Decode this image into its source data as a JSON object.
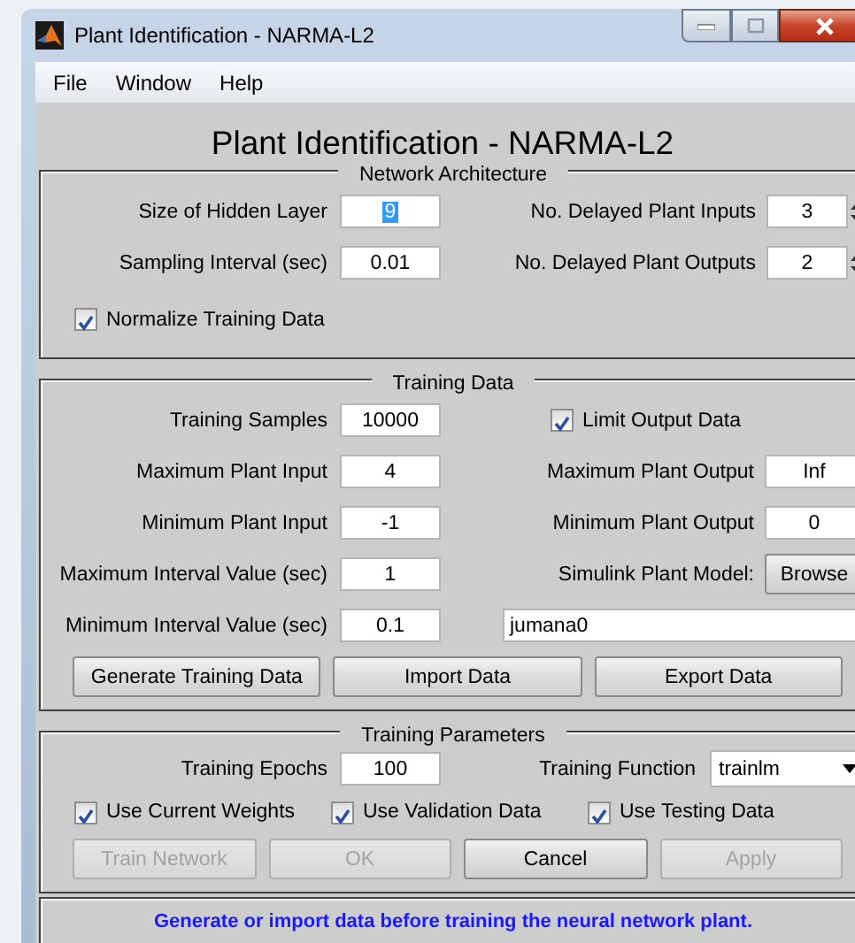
{
  "window": {
    "title": "Plant Identification - NARMA-L2"
  },
  "menu": [
    "File",
    "Window",
    "Help"
  ],
  "heading": "Plant Identification - NARMA-L2",
  "panels": [
    {
      "title": "Network Architecture",
      "rows": [
        {
          "kind": "pair",
          "items": [
            {
              "kind": "field",
              "label": "Size of Hidden Layer",
              "value": "9",
              "text_selected": true
            },
            {
              "kind": "spinner",
              "label": "No. Delayed Plant Inputs",
              "value": "3",
              "text_selected": false
            }
          ]
        },
        {
          "kind": "pair",
          "items": [
            {
              "kind": "field",
              "label": "Sampling Interval (sec)",
              "value": "0.01",
              "text_selected": false
            },
            {
              "kind": "spinner",
              "label": "No. Delayed Plant Outputs",
              "value": "2",
              "text_selected": false
            }
          ]
        },
        {
          "kind": "checks",
          "items": [
            {
              "label": "Normalize Training Data",
              "checked": true
            }
          ]
        }
      ]
    },
    {
      "title": "Training Data",
      "rows": [
        {
          "kind": "pair",
          "items": [
            {
              "kind": "field",
              "label": "Training Samples",
              "value": "10000",
              "text_selected": false
            },
            {
              "kind": "check",
              "label": "Limit Output Data",
              "checked": true
            }
          ]
        },
        {
          "kind": "pair",
          "items": [
            {
              "kind": "field",
              "label": "Maximum Plant Input",
              "value": "4",
              "text_selected": false
            },
            {
              "kind": "field",
              "label": "Maximum Plant Output",
              "value": "Inf",
              "text_selected": false
            }
          ]
        },
        {
          "kind": "pair",
          "items": [
            {
              "kind": "field",
              "label": "Minimum Plant Input",
              "value": "-1",
              "text_selected": false
            },
            {
              "kind": "field",
              "label": "Minimum Plant Output",
              "value": "0",
              "text_selected": false
            }
          ]
        },
        {
          "kind": "pair",
          "items": [
            {
              "kind": "field",
              "label": "Maximum Interval Value (sec)",
              "value": "1",
              "text_selected": false
            },
            {
              "kind": "button",
              "label": "Simulink Plant Model:",
              "value": "Browse"
            }
          ]
        },
        {
          "kind": "pair",
          "items": [
            {
              "kind": "field",
              "label": "Minimum Interval Value (sec)",
              "value": "0.1",
              "text_selected": false
            },
            {
              "kind": "wide_field",
              "value": "jumana0"
            }
          ]
        },
        {
          "kind": "buttons",
          "buttons": [
            {
              "label": "Generate Training Data",
              "disabled": false
            },
            {
              "label": "Import Data",
              "disabled": false
            },
            {
              "label": "Export Data",
              "disabled": false
            }
          ]
        }
      ]
    },
    {
      "title": "Training Parameters",
      "rows": [
        {
          "kind": "pair",
          "items": [
            {
              "kind": "field",
              "label": "Training Epochs",
              "value": "100",
              "text_selected": false
            },
            {
              "kind": "dropdown",
              "label": "Training Function",
              "value": "trainlm"
            }
          ]
        },
        {
          "kind": "checks",
          "items": [
            {
              "label": "Use Current Weights",
              "checked": true
            },
            {
              "label": "Use Validation Data",
              "checked": true
            },
            {
              "label": "Use Testing Data",
              "checked": true
            }
          ]
        },
        {
          "kind": "buttons",
          "buttons": [
            {
              "label": "Train Network",
              "disabled": true
            },
            {
              "label": "OK",
              "disabled": true
            },
            {
              "label": "Cancel",
              "disabled": false
            },
            {
              "label": "Apply",
              "disabled": true
            }
          ]
        }
      ]
    }
  ],
  "status": "Generate or import data before training the neural network plant."
}
